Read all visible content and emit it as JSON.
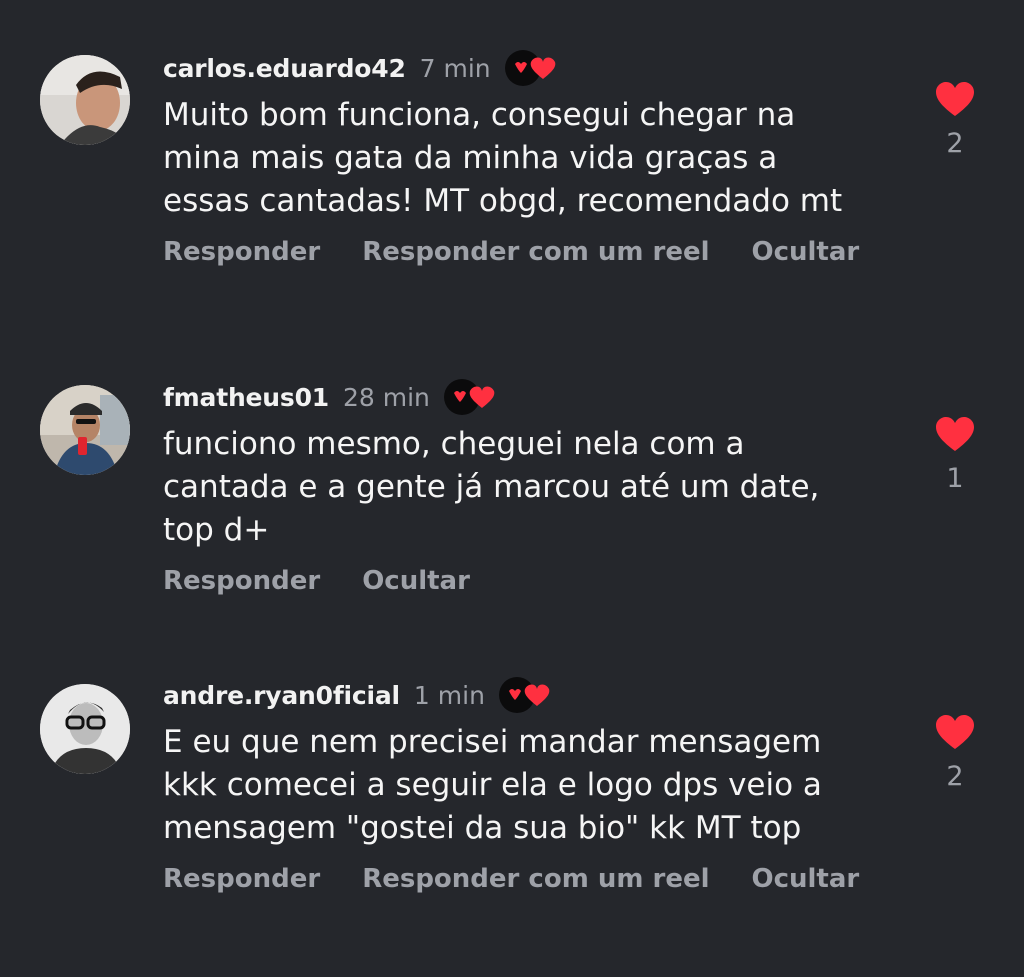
{
  "comments": [
    {
      "username": "carlos.eduardo42",
      "time": "7 min",
      "text": "Muito bom funciona, consegui chegar na\nmina mais gata da minha vida graças a\nessas cantadas! MT obgd, recomendado mt",
      "actions": [
        "Responder",
        "Responder com um reel",
        "Ocultar"
      ],
      "likes": "2"
    },
    {
      "username": "fmatheus01",
      "time": "28 min",
      "text": "funciono mesmo, cheguei nela com a\ncantada e a gente já marcou até um date,\ntop d+",
      "actions": [
        "Responder",
        "Ocultar"
      ],
      "likes": "1"
    },
    {
      "username": "andre.ryan0ficial",
      "time": "1 min",
      "text": "E eu que nem precisei mandar mensagem\nkkk comecei a seguir ela e logo dps veio a\nmensagem \"gostei da sua bio\" kk MT top",
      "actions": [
        "Responder",
        "Responder com um reel",
        "Ocultar"
      ],
      "likes": "2"
    }
  ],
  "colors": {
    "background": "#25272c",
    "heart": "#ff3040",
    "muted": "#9ea1a8"
  },
  "icons": {
    "like": "heart-icon",
    "creator_reaction": "creator-liked-badge-icon"
  }
}
